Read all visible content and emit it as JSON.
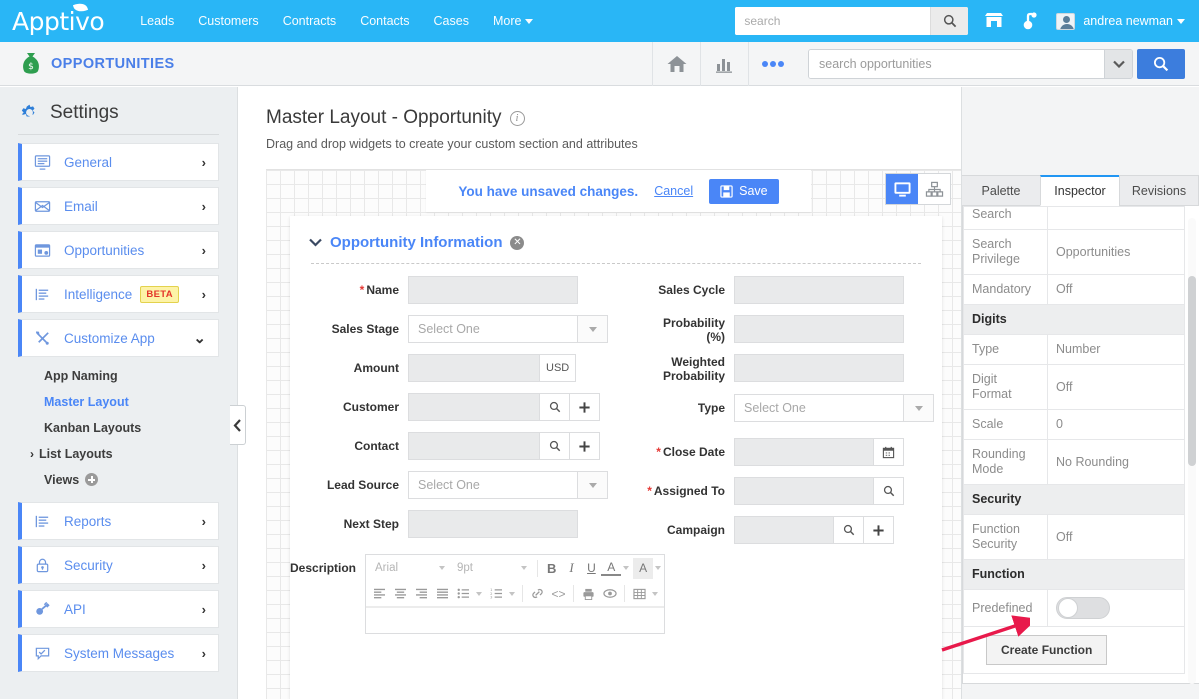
{
  "topnav": {
    "brand": "Apptivo",
    "links": [
      "Leads",
      "Customers",
      "Contracts",
      "Contacts",
      "Cases",
      "More"
    ],
    "search_placeholder": "search",
    "search_value": "",
    "search_icon": "search-icon",
    "store_icon": "store-icon",
    "notification_icon": "bell-icon",
    "username": "andrea newman",
    "brand_color": "#29b6f6"
  },
  "appbar": {
    "app_icon": "money-bag-icon",
    "app_title": "OPPORTUNITIES",
    "home_icon": "home-icon",
    "reports_icon": "bar-chart-icon",
    "more_icon": "ellipsis-icon",
    "search_placeholder": "search opportunities",
    "search_value": "",
    "search_caret_icon": "chevron-down-icon",
    "search_button_icon": "search-icon",
    "title_color": "#4a7fe8",
    "button_color": "#3c7ddd"
  },
  "sidebar": {
    "title": "Settings",
    "gear_icon": "gear-icon",
    "items": [
      {
        "label": "General",
        "icon": "monitor-list-icon",
        "chevron": "›",
        "badge": null
      },
      {
        "label": "Email",
        "icon": "envelope-icon",
        "chevron": "›",
        "badge": null
      },
      {
        "label": "Opportunities",
        "icon": "window-icon",
        "chevron": "›",
        "badge": null
      },
      {
        "label": "Intelligence",
        "icon": "list-lines-icon",
        "chevron": "›",
        "badge": "BETA"
      },
      {
        "label": "Customize App",
        "icon": "tools-icon",
        "chevron": "⌄",
        "badge": null
      }
    ],
    "sub_items": [
      {
        "label": "App Naming",
        "active": false,
        "caret": false,
        "plus": false
      },
      {
        "label": "Master Layout",
        "active": true,
        "caret": false,
        "plus": false
      },
      {
        "label": "Kanban Layouts",
        "active": false,
        "caret": false,
        "plus": false
      },
      {
        "label": "List Layouts",
        "active": false,
        "caret": true,
        "plus": false
      },
      {
        "label": "Views",
        "active": false,
        "caret": false,
        "plus": true
      }
    ],
    "items_bottom": [
      {
        "label": "Reports",
        "icon": "list-lines-icon",
        "chevron": "›"
      },
      {
        "label": "Security",
        "icon": "lock-icon",
        "chevron": "›"
      },
      {
        "label": "API",
        "icon": "plug-icon",
        "chevron": "›"
      },
      {
        "label": "System Messages",
        "icon": "message-check-icon",
        "chevron": "›"
      }
    ],
    "collapse_icon": "chevron-left-icon",
    "accent_color": "#4a86f7"
  },
  "main": {
    "page_title": "Master Layout - Opportunity",
    "info_icon": "info-icon",
    "subtitle": "Drag and drop widgets to create your custom section and attributes",
    "unsaved_text": "You have unsaved changes.",
    "cancel_label": "Cancel",
    "save_label": "Save",
    "save_icon": "floppy-disk-icon",
    "device_desktop_icon": "desktop-icon",
    "device_tree_icon": "sitemap-icon",
    "device_selected": "desktop"
  },
  "form": {
    "section_title": "Opportunity Information",
    "collapse_icon": "chevron-down-icon",
    "close_icon": "close-circle-icon",
    "select_placeholder": "Select One",
    "left_fields": [
      {
        "label": "Name",
        "required": true,
        "type": "text"
      },
      {
        "label": "Sales Stage",
        "required": false,
        "type": "select",
        "value": "Select One"
      },
      {
        "label": "Amount",
        "required": false,
        "type": "text-addon",
        "addon": "USD"
      },
      {
        "label": "Customer",
        "required": false,
        "type": "text-search-plus",
        "addon1": "search-icon",
        "addon2": "plus-icon"
      },
      {
        "label": "Contact",
        "required": false,
        "type": "text-search-plus",
        "addon1": "search-icon",
        "addon2": "plus-icon"
      },
      {
        "label": "Lead Source",
        "required": false,
        "type": "select",
        "value": "Select One"
      },
      {
        "label": "Next Step",
        "required": false,
        "type": "text"
      },
      {
        "label": "Description",
        "required": false,
        "type": "editor"
      }
    ],
    "right_fields": [
      {
        "label": "Sales Cycle",
        "required": false,
        "type": "text"
      },
      {
        "label": "Probability (%)",
        "required": false,
        "type": "text"
      },
      {
        "label": "Weighted Probability",
        "required": false,
        "type": "text"
      },
      {
        "label": "Type",
        "required": false,
        "type": "select",
        "value": "Select One"
      },
      {
        "label": "Close Date",
        "required": true,
        "type": "text-addon-icon",
        "addon1": "calendar-icon"
      },
      {
        "label": "Assigned To",
        "required": true,
        "type": "text-addon-icon",
        "addon1": "search-icon"
      },
      {
        "label": "Campaign",
        "required": false,
        "type": "text-search-plus",
        "addon1": "search-icon",
        "addon2": "plus-icon"
      }
    ],
    "editor": {
      "font_family": "Arial",
      "font_size": "9pt",
      "bold": "B",
      "italic": "I",
      "underline": "U",
      "text_color": "A",
      "highlight_color": "A",
      "align_left_icon": "align-left-icon",
      "align_center_icon": "align-center-icon",
      "align_right_icon": "align-right-icon",
      "align_justify_icon": "align-justify-icon",
      "bullet_list_icon": "bullet-list-icon",
      "number_list_icon": "number-list-icon",
      "link_icon": "link-icon",
      "code_icon": "code-icon",
      "print_icon": "print-icon",
      "preview_icon": "eye-icon",
      "table_icon": "table-icon"
    }
  },
  "right_panel": {
    "tabs": [
      {
        "label": "Palette",
        "active": false
      },
      {
        "label": "Inspector",
        "active": true
      },
      {
        "label": "Revisions",
        "active": false
      }
    ],
    "rows": [
      {
        "kind": "row",
        "key": "Search",
        "value": "",
        "clipped": true
      },
      {
        "kind": "row",
        "key": "Search Privilege",
        "value": "Opportunities"
      },
      {
        "kind": "row",
        "key": "Mandatory",
        "value": "Off"
      },
      {
        "kind": "group",
        "key": "Digits"
      },
      {
        "kind": "row",
        "key": "Type",
        "value": "Number"
      },
      {
        "kind": "row",
        "key": "Digit Format",
        "value": "Off"
      },
      {
        "kind": "row",
        "key": "Scale",
        "value": "0"
      },
      {
        "kind": "row",
        "key": "Rounding Mode",
        "value": "No Rounding"
      },
      {
        "kind": "group",
        "key": "Security"
      },
      {
        "kind": "row",
        "key": "Function Security",
        "value": "Off"
      },
      {
        "kind": "group",
        "key": "Function"
      },
      {
        "kind": "toggle",
        "key": "Predefined",
        "value": "off"
      },
      {
        "kind": "button",
        "key": "",
        "value": "Create Function"
      }
    ],
    "active_tab_color": "#2196f3"
  },
  "annotation": {
    "arrow_color": "#e8194b",
    "arrow_icon": "arrow-pointer"
  }
}
